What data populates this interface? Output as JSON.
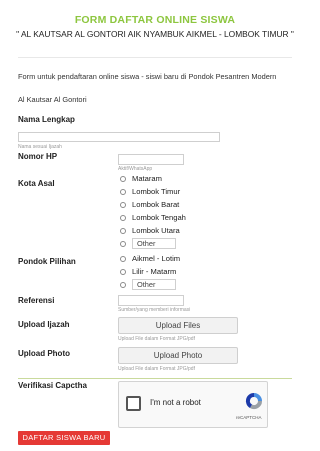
{
  "header": {
    "title": "FORM DAFTAR ONLINE SISWA",
    "subtitle": "\" AL KAUTSAR AL GONTORI AIK NYAMBUK AIKMEL - LOMBOK TIMUR \""
  },
  "intro": {
    "line1": "Form untuk pendaftaran online siswa - siswi baru di Pondok Pesantren Modern",
    "line2": "Al Kautsar Al Gontori"
  },
  "fields": {
    "nama": {
      "label": "Nama Lengkap",
      "value": "",
      "hint": "Nama sesuai Ijazah"
    },
    "hp": {
      "label": "Nomor HP",
      "value": "",
      "hint": "Aktif/WhatsApp"
    },
    "kota": {
      "label": "Kota Asal",
      "options": [
        "Mataram",
        "Lombok Timur",
        "Lombok Barat",
        "Lombok Tengah",
        "Lombok Utara"
      ],
      "other_placeholder": "Other"
    },
    "pondok": {
      "label": "Pondok Pilihan",
      "options": [
        "Aikmel - Lotim",
        "Lilir - Matarm"
      ],
      "other_placeholder": "Other"
    },
    "referensi": {
      "label": "Referensi",
      "value": "",
      "hint": "Sumber/yang memberi informasi"
    },
    "ijazah": {
      "label": "Upload Ijazah",
      "button": "Upload Files",
      "hint": "Upload File dalam Format JPG/pdf"
    },
    "photo": {
      "label": "Upload Photo",
      "button": "Upload Photo",
      "hint": "Upload File dalam Format JPG/pdf"
    },
    "captcha": {
      "label": "Verifikasi Capctha",
      "checkbox_label": "I'm not a robot",
      "brand": "reCAPTCHA"
    }
  },
  "submit": {
    "label": "DAFTAR SISWA BARU"
  },
  "colors": {
    "title": "#8dc63f",
    "submit": "#e53935",
    "recaptcha": "#4a90e2"
  }
}
